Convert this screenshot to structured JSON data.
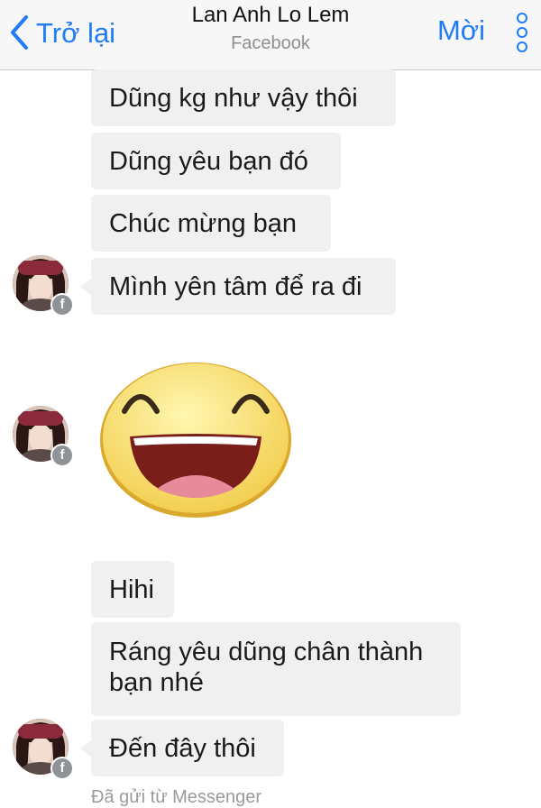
{
  "header": {
    "back_label": "Trở lại",
    "contact_name": "Lan Anh Lo Lem",
    "contact_source": "Facebook",
    "invite_label": "Mời"
  },
  "messages": [
    {
      "text": "Dũng kg như vậy thôi"
    },
    {
      "text": "Dũng yêu bạn đó"
    },
    {
      "text": "Chúc mừng bạn"
    },
    {
      "text": "Mình yên tâm để ra đi"
    },
    {
      "sticker": "laughing-smiley-sticker"
    },
    {
      "text": "Hihi"
    },
    {
      "text": "Ráng yêu dũng chân thành bạn nhé"
    },
    {
      "text": "Đến đây thôi"
    }
  ],
  "footer": {
    "sent_from": "Đã gửi từ Messenger"
  },
  "colors": {
    "accent": "#1f7cf6",
    "bubble": "#f1f0f0",
    "navbar": "#f7f7f8"
  },
  "icons": [
    "back-chevron-icon",
    "more-dots-icon",
    "facebook-badge-icon",
    "laughing-smiley-sticker"
  ]
}
